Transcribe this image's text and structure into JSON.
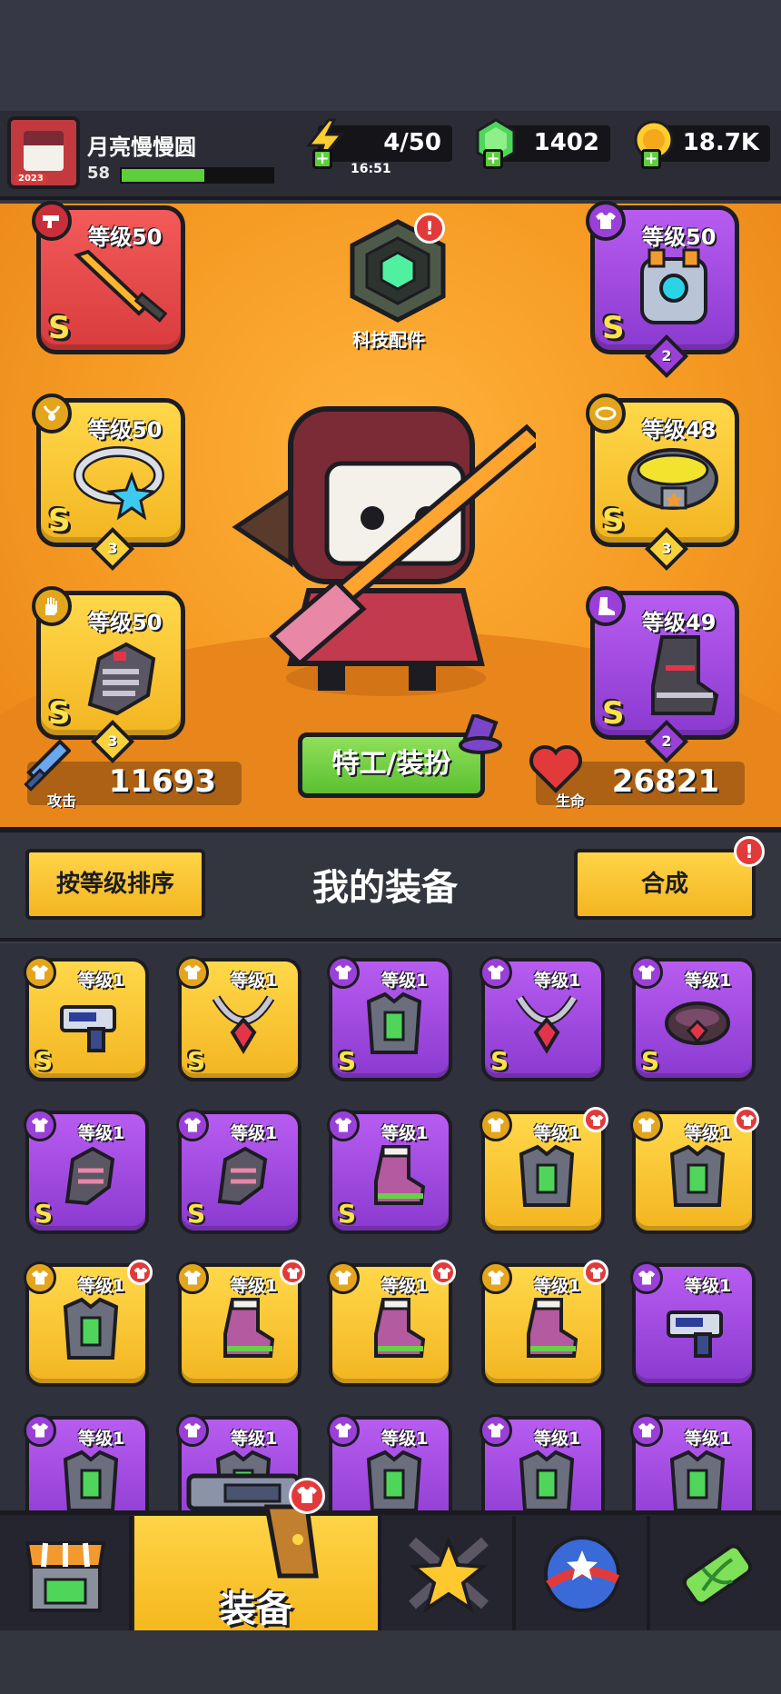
{
  "player": {
    "name": "月亮慢慢圆",
    "level": "58",
    "avatar_badge": "2023",
    "xp_fraction": 0.55
  },
  "resources": {
    "energy": "4/50",
    "energy_timer": "16:51",
    "gems": "1402",
    "coins": "18.7K"
  },
  "equipped": {
    "weapon": {
      "level": "等级50",
      "rank": "S"
    },
    "armor": {
      "level": "等级50",
      "rank": "S",
      "stars": "2"
    },
    "necklace": {
      "level": "等级50",
      "rank": "S",
      "stars": "3"
    },
    "belt": {
      "level": "等级48",
      "rank": "S",
      "stars": "3"
    },
    "gloves": {
      "level": "等级50",
      "rank": "S",
      "stars": "3"
    },
    "boots": {
      "level": "等级49",
      "rank": "S",
      "stars": "2"
    }
  },
  "tech_parts": {
    "label": "科技配件",
    "alert": "!"
  },
  "stats": {
    "attack_label": "攻击",
    "attack": "11693",
    "hp_label": "生命",
    "hp": "26821"
  },
  "agent_button": "特工/装扮",
  "panel": {
    "sort_button": "按等级排序",
    "title": "我的装备",
    "merge_button": "合成",
    "merge_alert": "!"
  },
  "inventory": [
    {
      "level": "等级1",
      "rank": "S",
      "rarity": "gold",
      "type": "weapon-icon",
      "new": false
    },
    {
      "level": "等级1",
      "rank": "S",
      "rarity": "gold",
      "type": "necklace-icon",
      "new": false
    },
    {
      "level": "等级1",
      "rank": "S",
      "rarity": "purple",
      "type": "armor-icon",
      "new": false
    },
    {
      "level": "等级1",
      "rank": "S",
      "rarity": "purple",
      "type": "necklace-icon",
      "new": false
    },
    {
      "level": "等级1",
      "rank": "S",
      "rarity": "purple",
      "type": "belt-icon",
      "new": false
    },
    {
      "level": "等级1",
      "rank": "S",
      "rarity": "purple",
      "type": "gloves-icon",
      "new": false
    },
    {
      "level": "等级1",
      "rank": "S",
      "rarity": "purple",
      "type": "gloves-icon",
      "new": false
    },
    {
      "level": "等级1",
      "rank": "S",
      "rarity": "purple",
      "type": "boots-icon",
      "new": false
    },
    {
      "level": "等级1",
      "rank": "",
      "rarity": "gold",
      "type": "armor-icon",
      "new": true
    },
    {
      "level": "等级1",
      "rank": "",
      "rarity": "gold",
      "type": "armor-icon",
      "new": true
    },
    {
      "level": "等级1",
      "rank": "",
      "rarity": "gold",
      "type": "armor-icon",
      "new": true
    },
    {
      "level": "等级1",
      "rank": "",
      "rarity": "gold",
      "type": "boots-icon",
      "new": true
    },
    {
      "level": "等级1",
      "rank": "",
      "rarity": "gold",
      "type": "boots-icon",
      "new": true
    },
    {
      "level": "等级1",
      "rank": "",
      "rarity": "gold",
      "type": "boots-icon",
      "new": true
    },
    {
      "level": "等级1",
      "rank": "",
      "rarity": "purple",
      "type": "weapon-icon",
      "new": false
    },
    {
      "level": "等级1",
      "rank": "",
      "rarity": "purple",
      "type": "armor-icon",
      "new": false
    },
    {
      "level": "等级1",
      "rank": "",
      "rarity": "purple",
      "type": "armor-icon",
      "new": false
    },
    {
      "level": "等级1",
      "rank": "",
      "rarity": "purple",
      "type": "armor-icon",
      "new": false
    },
    {
      "level": "等级1",
      "rank": "",
      "rarity": "purple",
      "type": "armor-icon",
      "new": false
    },
    {
      "level": "等级1",
      "rank": "",
      "rarity": "purple",
      "type": "armor-icon",
      "new": false
    }
  ],
  "nav": {
    "tabs": [
      {
        "name": "shop",
        "icon": "shop-icon"
      },
      {
        "name": "equipment",
        "label": "装备",
        "icon": "revolver-icon",
        "active": true
      },
      {
        "name": "heroes",
        "icon": "swords-star-icon"
      },
      {
        "name": "world",
        "icon": "planet-icon"
      },
      {
        "name": "dna",
        "icon": "dna-capsule-icon"
      }
    ]
  },
  "colors": {
    "accent_yellow": "#f3b521",
    "rarity_gold": "#ffd84a",
    "rarity_purple": "#a64ee4",
    "rarity_red": "#e64a4a",
    "stage_orange": "#f59a23",
    "green_button": "#6fcb3e",
    "alert_red": "#e23a3a"
  }
}
